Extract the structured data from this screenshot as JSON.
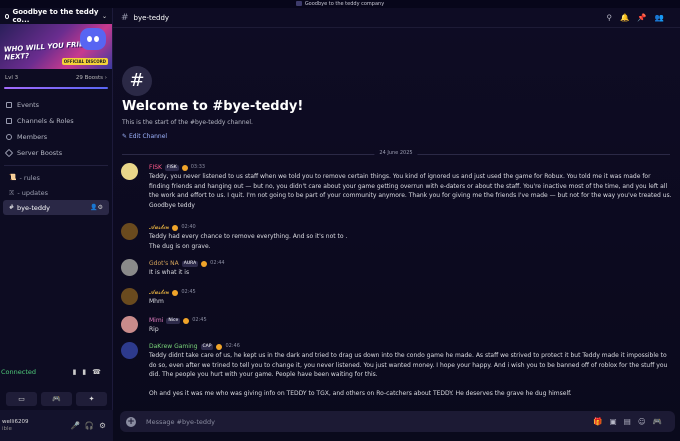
{
  "window_title": "Goodbye to the teddy company",
  "server": {
    "name": "Goodbye to the teddy co...",
    "banner_text": "WHO WILL YOU FRIEND NEXT?",
    "banner_chip": "OFFICIAL DISCORD",
    "level": "Lvl 3",
    "boosts": "29 Boosts",
    "nav": [
      {
        "label": "Events"
      },
      {
        "label": "Channels & Roles"
      },
      {
        "label": "Members"
      },
      {
        "label": "Server Boosts"
      }
    ],
    "channels": [
      {
        "prefix": "📜",
        "label": "- rules"
      },
      {
        "prefix": "🇽",
        "label": "- updates"
      },
      {
        "prefix": "#",
        "label": "bye-teddy"
      }
    ]
  },
  "voice": {
    "status": "Connected"
  },
  "user": {
    "name": "welli6209",
    "status": "ible"
  },
  "channel": {
    "name": "bye-teddy",
    "welcome_title": "Welcome to #bye-teddy!",
    "welcome_sub": "This is the start of the #bye-teddy channel.",
    "edit_label": "Edit Channel",
    "date_divider": "24 June 2025"
  },
  "messages": [
    {
      "author": "FISK",
      "author_color": "#ff5b8a",
      "tag": "FISK",
      "time": "03:33",
      "lines": [
        "Teddy, you never listened to us staff when we told you to remove certain things. You kind of ignored us and just used the game for Robux. You told me it was made for finding friends and hanging out — but no, you didn't care about your game getting overrun with e-daters or about the staff. You're inactive most of the time, and you left all the work and effort to us. I quit. I'm not going to be part of your community anymore. Thank you for giving me the friends I've made — but not for the way you've treated us.",
        "Goodbye teddy"
      ]
    },
    {
      "author": "𝓐𝓾𝓼𝓽𝓲𝓷",
      "author_color": "#e8b341",
      "tag": "",
      "time": "02:40",
      "lines": [
        "Teddy had every chance to remove everything. And so it's not to .",
        "The dug is on grave."
      ]
    },
    {
      "author": "Gdot's NA",
      "author_color": "#d2a25a",
      "tag": "AURA",
      "time": "02:44",
      "lines": [
        "It is what it is"
      ]
    },
    {
      "author": "𝓐𝓾𝓼𝓽𝓲𝓷",
      "author_color": "#e8b341",
      "tag": "",
      "time": "02:45",
      "lines": [
        "Mhm"
      ]
    },
    {
      "author": "Mimi",
      "author_color": "#e07dbf",
      "tag": "Nice",
      "time": "02:45",
      "lines": [
        "Rip"
      ]
    },
    {
      "author": "DaKrew Gaming",
      "author_color": "#7ad67a",
      "tag": "CAP",
      "time": "02:46",
      "lines": [
        "Teddy didnt take care of us, he kept us in the dark and tried to drag us down into the condo game he made. As staff we strived to protect it but Teddy made it impossible to do so, even after we trined to tell you to change it, you never listened. You just wanted money. I hope your happy. And i wish you to be banned off of roblox for the stuff you did. The people you hurt with your game. People have been waiting for this.",
        "",
        "Oh and yes it was me who was giving info on TEDDY to TGX, and others on Ro-catchers about TEDDY. He deserves the grave he dug himself."
      ]
    }
  ],
  "composer": {
    "placeholder": "Message #bye-teddy"
  }
}
